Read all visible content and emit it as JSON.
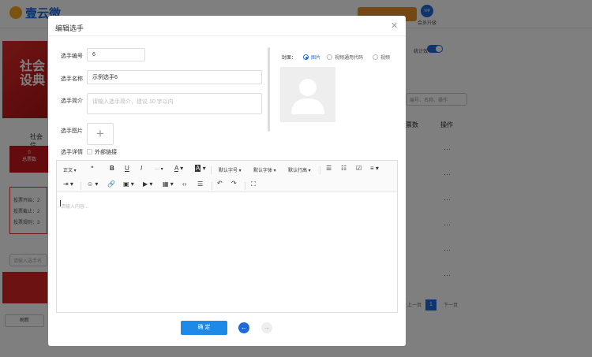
{
  "background": {
    "logo_text": "壹云微",
    "vip_label": "会员升级",
    "vip_badge": "VIP",
    "banner_text": "社会\n设典",
    "section_title": "社会信",
    "stat_value": "0",
    "stat_label": "总票数",
    "info_lines": [
      "投票开始：2",
      "投票截止：2",
      "投票规则：3"
    ],
    "left_search_placeholder": "请输入选手名",
    "refresh_label": "刷新",
    "toggle_label": "统计效率",
    "right_search_placeholder": "编号、名称、操作",
    "col_header_1": "票数",
    "col_header_2": "操作",
    "row_actions": [
      "···",
      "···",
      "···",
      "···",
      "···",
      "···",
      "···"
    ],
    "prev_page": "上一页",
    "current_page": "1",
    "next_page": "下一页"
  },
  "modal": {
    "title": "编辑选手",
    "close_icon": "close-icon",
    "fields": {
      "number_label": "选手编号",
      "number_value": "6",
      "name_label": "选手名称",
      "name_value": "示例选手6",
      "intro_label": "选手简介",
      "intro_placeholder": "请输入选手简介，建议 10 字以内",
      "image_label": "选手图片",
      "image_upload": "+",
      "detail_label": "选手详情",
      "external_link_label": "外部链接"
    },
    "cover": {
      "label": "封面：",
      "options": [
        "图片",
        "视频通用代码",
        "视频"
      ],
      "selected": "图片"
    },
    "editor": {
      "toolbar": {
        "paragraph": "正文",
        "quote": "❝",
        "bold": "B",
        "underline": "U",
        "italic": "I",
        "more": "···",
        "font_color": "A",
        "bg_color": "A",
        "font_size": "默认字号",
        "font_family": "默认字体",
        "line_height": "默认行高",
        "undo": "↶",
        "redo": "↷"
      },
      "placeholder": "请输入内容..."
    },
    "confirm_label": "确 定",
    "prev_icon": "arrow-left-icon",
    "next_icon": "arrow-right-icon"
  }
}
